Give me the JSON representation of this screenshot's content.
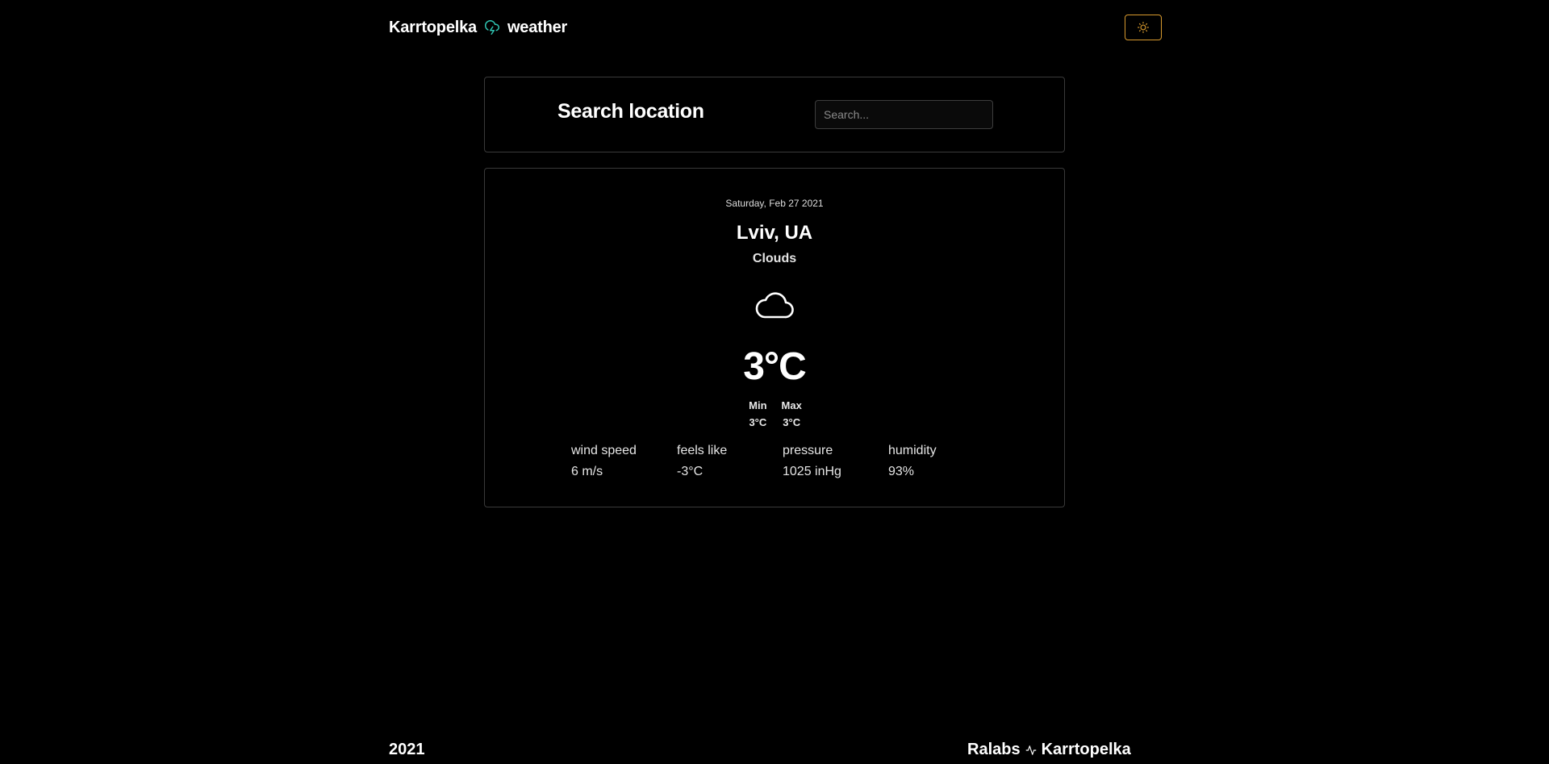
{
  "header": {
    "brand_left": "Karrtopelka",
    "brand_right": "weather",
    "brand_icon": "cloud-lightning-icon",
    "theme_toggle_icon": "sun-icon",
    "accent_color": "#2fc4b2",
    "toggle_color": "#d89a2e"
  },
  "search": {
    "title": "Search location",
    "placeholder": "Search..."
  },
  "weather": {
    "date": "Saturday, Feb 27 2021",
    "city": "Lviv, UA",
    "condition": "Clouds",
    "condition_icon": "cloud-icon",
    "temperature": "3°C",
    "min_label": "Min",
    "min_value": "3°C",
    "max_label": "Max",
    "max_value": "3°C",
    "stats": [
      {
        "label": "wind speed",
        "value": "6 m/s"
      },
      {
        "label": "feels like",
        "value": "-3°C"
      },
      {
        "label": "pressure",
        "value": "1025 inHg"
      },
      {
        "label": "humidity",
        "value": "93%"
      }
    ]
  },
  "footer": {
    "year": "2021",
    "credit_left": "Ralabs",
    "credit_icon": "activity-icon",
    "credit_right": "Karrtopelka"
  }
}
